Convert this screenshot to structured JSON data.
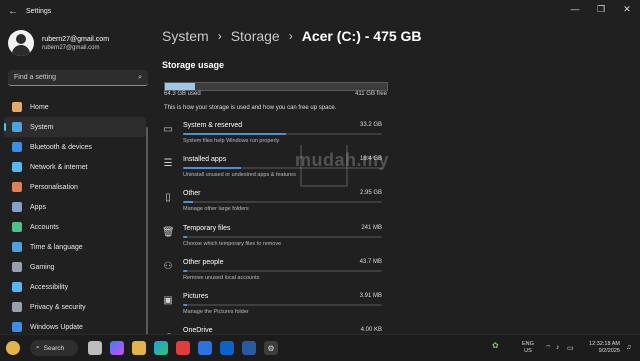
{
  "window": {
    "title": "Settings",
    "back_icon": "back-arrow-icon"
  },
  "account": {
    "name": "rubern27@gmail.com",
    "email": "rubern27@gmail.com"
  },
  "search": {
    "placeholder": "Find a setting"
  },
  "nav": [
    {
      "label": "Home",
      "color": "#e8a76a"
    },
    {
      "label": "System",
      "color": "#4aa3df",
      "active": true
    },
    {
      "label": "Bluetooth & devices",
      "color": "#3a8ee6"
    },
    {
      "label": "Network & internet",
      "color": "#58b6f0"
    },
    {
      "label": "Personalisation",
      "color": "#e37e55"
    },
    {
      "label": "Apps",
      "color": "#8aa0c8"
    },
    {
      "label": "Accounts",
      "color": "#4fc08d"
    },
    {
      "label": "Time & language",
      "color": "#4aa3df"
    },
    {
      "label": "Gaming",
      "color": "#9aa0aa"
    },
    {
      "label": "Accessibility",
      "color": "#58b6f0"
    },
    {
      "label": "Privacy & security",
      "color": "#9aa0aa"
    },
    {
      "label": "Windows Update",
      "color": "#3a8ee6"
    }
  ],
  "breadcrumb": {
    "c1": "System",
    "c2": "Storage",
    "c3": "Acer (C:) - 475 GB",
    "sep": "›"
  },
  "storage": {
    "heading": "Storage usage",
    "used_label": "64.3 GB used",
    "free_label": "411 GB free",
    "used_fraction": 0.135,
    "description": "This is how your storage is used and how you can free up space."
  },
  "categories": [
    {
      "name": "System & reserved",
      "size": "33.2 GB",
      "sub": "System files help Windows run properly",
      "fraction": 0.52,
      "icon": "system-monitor-icon"
    },
    {
      "name": "Installed apps",
      "size": "18.4 GB",
      "sub": "Uninstall unused or undesired apps & features",
      "fraction": 0.29,
      "icon": "apps-list-icon"
    },
    {
      "name": "Other",
      "size": "2.95 GB",
      "sub": "Manage other large folders",
      "fraction": 0.05,
      "icon": "file-icon"
    },
    {
      "name": "Temporary files",
      "size": "241 MB",
      "sub": "Choose which temporary files to remove",
      "fraction": 0.01,
      "icon": "trash-icon"
    },
    {
      "name": "Other people",
      "size": "43.7 MB",
      "sub": "Remove unused local accounts",
      "fraction": 0.005,
      "icon": "people-icon"
    },
    {
      "name": "Pictures",
      "size": "3.91 MB",
      "sub": "Manage the Pictures folder",
      "fraction": 0.002,
      "icon": "image-icon"
    },
    {
      "name": "OneDrive",
      "size": "4.00 KB",
      "sub": "",
      "fraction": 0.0,
      "icon": "cloud-icon"
    }
  ],
  "watermark": "mudah.my",
  "taskbar": {
    "search_label": "Search",
    "lang_line1": "ENG",
    "lang_line2": "US",
    "time": "12:32:18 AM",
    "date": "9/2/2025"
  },
  "colors": {
    "accent": "#4cc2ff",
    "bar_fill": "#4d8fd6",
    "usage_fill": "#9cc7ea"
  }
}
